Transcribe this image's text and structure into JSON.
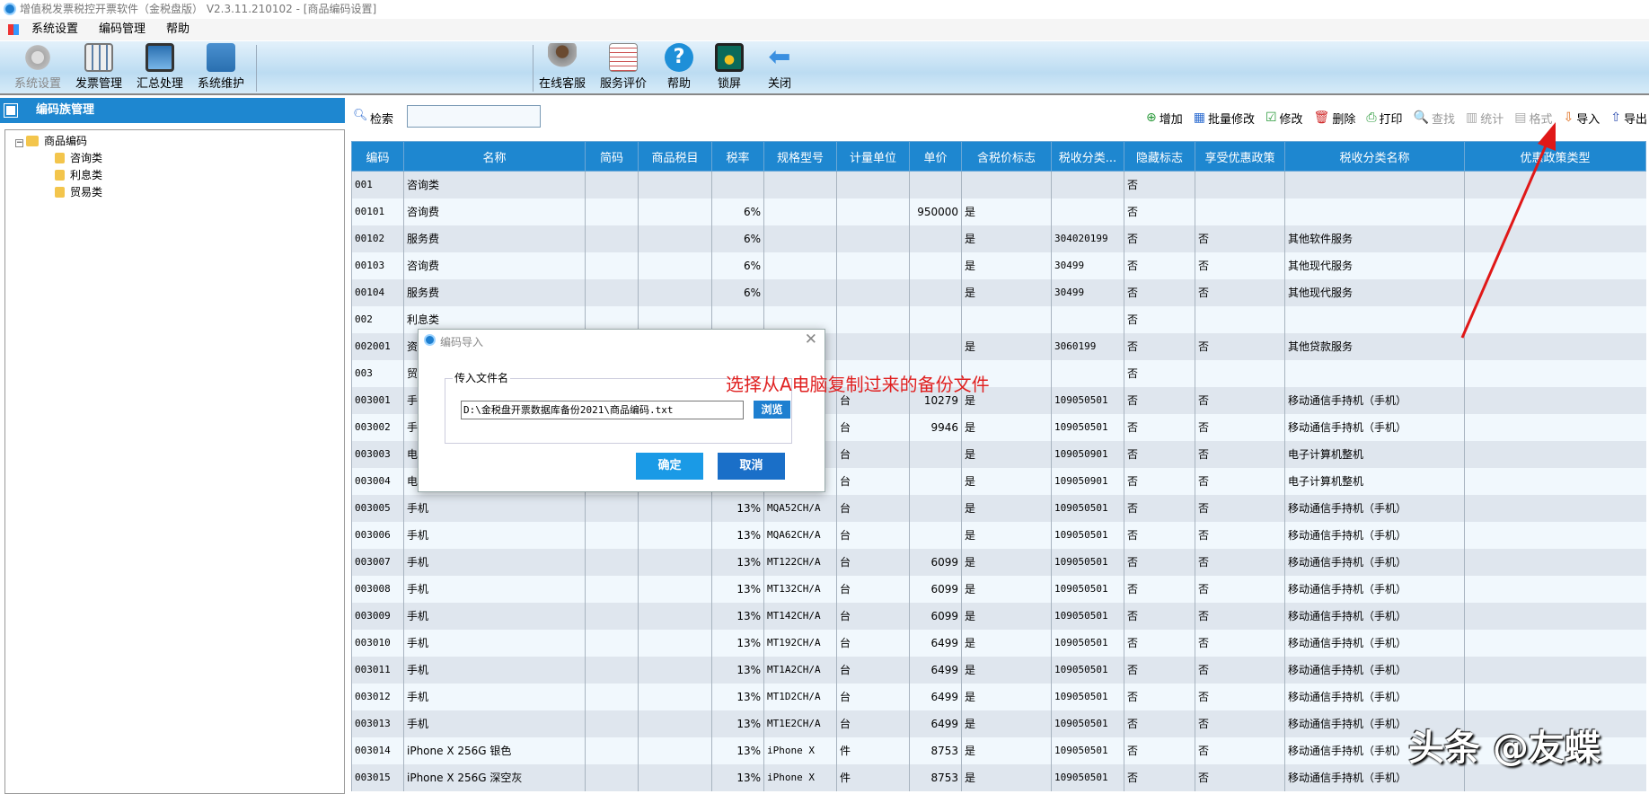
{
  "window": {
    "title": "增值税发票税控开票软件（金税盘版） V2.3.11.210102 - [商品编码设置]"
  },
  "menu": [
    "系统设置",
    "编码管理",
    "帮助"
  ],
  "toolbar_left": [
    "系统设置",
    "发票管理",
    "汇总处理",
    "系统维护"
  ],
  "toolbar_right": [
    "在线客服",
    "服务评价",
    "帮助",
    "锁屏",
    "关闭"
  ],
  "left_panel": {
    "title": "编码族管理",
    "tree": {
      "root": "商品编码",
      "children": [
        "咨询类",
        "利息类",
        "贸易类"
      ]
    }
  },
  "search": {
    "label": "检索",
    "value": ""
  },
  "actions": [
    {
      "label": "增加",
      "icon": "⊕",
      "color": "#2a9a3a"
    },
    {
      "label": "批量修改",
      "icon": "▦",
      "color": "#2a6ad0"
    },
    {
      "label": "修改",
      "icon": "☑",
      "color": "#2a9a3a"
    },
    {
      "label": "删除",
      "icon": "🗑",
      "color": "#d02a2a"
    },
    {
      "label": "打印",
      "icon": "⎙",
      "color": "#2a9a3a"
    },
    {
      "label": "查找",
      "icon": "🔍",
      "disabled": true
    },
    {
      "label": "统计",
      "icon": "▥",
      "disabled": true
    },
    {
      "label": "格式",
      "icon": "▤",
      "disabled": true
    },
    {
      "label": "导入",
      "icon": "⇩",
      "color": "#e07020"
    },
    {
      "label": "导出",
      "icon": "⇧",
      "color": "#3050b0"
    }
  ],
  "table": {
    "columns": [
      "编码",
      "名称",
      "简码",
      "商品税目",
      "税率",
      "规格型号",
      "计量单位",
      "单价",
      "含税价标志",
      "税收分类...",
      "隐藏标志",
      "享受优惠政策",
      "税收分类名称",
      "优惠政策类型"
    ],
    "rows": [
      [
        "001",
        "咨询类",
        "",
        "",
        "",
        "",
        "",
        "",
        "",
        "",
        "否",
        "",
        "",
        ""
      ],
      [
        "00101",
        "咨询费",
        "",
        "",
        "6%",
        "",
        "",
        "950000",
        "是",
        "",
        "否",
        "",
        "",
        ""
      ],
      [
        "00102",
        "服务费",
        "",
        "",
        "6%",
        "",
        "",
        "",
        "是",
        "304020199",
        "否",
        "否",
        "其他软件服务",
        ""
      ],
      [
        "00103",
        "咨询费",
        "",
        "",
        "6%",
        "",
        "",
        "",
        "是",
        "30499",
        "否",
        "否",
        "其他现代服务",
        ""
      ],
      [
        "00104",
        "服务费",
        "",
        "",
        "6%",
        "",
        "",
        "",
        "是",
        "30499",
        "否",
        "否",
        "其他现代服务",
        ""
      ],
      [
        "002",
        "利息类",
        "",
        "",
        "",
        "",
        "",
        "",
        "",
        "",
        "否",
        "",
        "",
        ""
      ],
      [
        "002001",
        "资",
        "",
        "",
        "",
        "",
        "",
        "",
        "是",
        "3060199",
        "否",
        "否",
        "其他贷款服务",
        ""
      ],
      [
        "003",
        "贸",
        "",
        "",
        "",
        "",
        "",
        "",
        "",
        "",
        "否",
        "",
        "",
        ""
      ],
      [
        "003001",
        "手",
        "",
        "",
        "",
        "",
        "台",
        "10279",
        "是",
        "109050501",
        "否",
        "否",
        "移动通信手持机（手机）",
        ""
      ],
      [
        "003002",
        "手",
        "",
        "",
        "",
        "",
        "台",
        "9946",
        "是",
        "109050501",
        "否",
        "否",
        "移动通信手持机（手机）",
        ""
      ],
      [
        "003003",
        "电",
        "",
        "",
        "",
        "",
        "台",
        "",
        "是",
        "109050901",
        "否",
        "否",
        "电子计算机整机",
        ""
      ],
      [
        "003004",
        "电",
        "",
        "",
        "",
        "",
        "台",
        "",
        "是",
        "109050901",
        "否",
        "否",
        "电子计算机整机",
        ""
      ],
      [
        "003005",
        "手机",
        "",
        "",
        "13%",
        "MQA52CH/A",
        "台",
        "",
        "是",
        "109050501",
        "否",
        "否",
        "移动通信手持机（手机）",
        ""
      ],
      [
        "003006",
        "手机",
        "",
        "",
        "13%",
        "MQA62CH/A",
        "台",
        "",
        "是",
        "109050501",
        "否",
        "否",
        "移动通信手持机（手机）",
        ""
      ],
      [
        "003007",
        "手机",
        "",
        "",
        "13%",
        "MT122CH/A",
        "台",
        "6099",
        "是",
        "109050501",
        "否",
        "否",
        "移动通信手持机（手机）",
        ""
      ],
      [
        "003008",
        "手机",
        "",
        "",
        "13%",
        "MT132CH/A",
        "台",
        "6099",
        "是",
        "109050501",
        "否",
        "否",
        "移动通信手持机（手机）",
        ""
      ],
      [
        "003009",
        "手机",
        "",
        "",
        "13%",
        "MT142CH/A",
        "台",
        "6099",
        "是",
        "109050501",
        "否",
        "否",
        "移动通信手持机（手机）",
        ""
      ],
      [
        "003010",
        "手机",
        "",
        "",
        "13%",
        "MT192CH/A",
        "台",
        "6499",
        "是",
        "109050501",
        "否",
        "否",
        "移动通信手持机（手机）",
        ""
      ],
      [
        "003011",
        "手机",
        "",
        "",
        "13%",
        "MT1A2CH/A",
        "台",
        "6499",
        "是",
        "109050501",
        "否",
        "否",
        "移动通信手持机（手机）",
        ""
      ],
      [
        "003012",
        "手机",
        "",
        "",
        "13%",
        "MT1D2CH/A",
        "台",
        "6499",
        "是",
        "109050501",
        "否",
        "否",
        "移动通信手持机（手机）",
        ""
      ],
      [
        "003013",
        "手机",
        "",
        "",
        "13%",
        "MT1E2CH/A",
        "台",
        "6499",
        "是",
        "109050501",
        "否",
        "否",
        "移动通信手持机（手机）",
        ""
      ],
      [
        "003014",
        "iPhone X 256G 银色",
        "",
        "",
        "13%",
        "iPhone X",
        "件",
        "8753",
        "是",
        "109050501",
        "否",
        "否",
        "移动通信手持机（手机）",
        ""
      ],
      [
        "003015",
        "iPhone X 256G 深空灰",
        "",
        "",
        "13%",
        "iPhone X",
        "件",
        "8753",
        "是",
        "109050501",
        "否",
        "否",
        "移动通信手持机（手机）",
        ""
      ]
    ]
  },
  "dialog": {
    "title": "编码导入",
    "group_label": "传入文件名",
    "file_path": "D:\\金税盘开票数据库备份2021\\商品编码.txt",
    "browse": "浏览",
    "ok": "确定",
    "cancel": "取消"
  },
  "annotation": "选择从A电脑复制过来的备份文件",
  "watermark": "头条 @友蝶"
}
